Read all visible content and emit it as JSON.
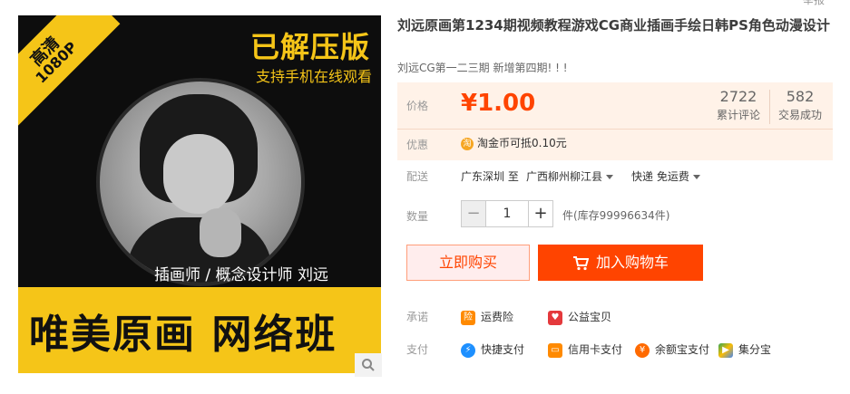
{
  "top_cut": "举报",
  "image": {
    "ribbon_line1": "高清",
    "ribbon_line2": "1080P",
    "badge": "已解压版",
    "mobile_text": "支持手机在线观看",
    "role_text": "插画师 / 概念设计师  刘远",
    "banner_text": "唯美原画 网络班",
    "zoom_icon": "search-icon"
  },
  "product": {
    "title": "刘远原画第1234期视频教程游戏CG商业插画手绘日韩PS角色动漫设计",
    "subtitle": "刘远CG第一二三期 新增第四期! ! !"
  },
  "price": {
    "label": "价格",
    "currency": "¥",
    "value": "1.00",
    "reviews_count": "2722",
    "reviews_label": "累计评论",
    "sales_count": "582",
    "sales_label": "交易成功",
    "promo_label": "优惠",
    "promo_text": "淘金币可抵0.10元"
  },
  "shipping": {
    "label": "配送",
    "from": "广东深圳 至",
    "to": "广西柳州柳江县",
    "method": "快递 免运费"
  },
  "quantity": {
    "label": "数量",
    "value": "1",
    "minus": "−",
    "plus": "+",
    "stock": "件(库存99996634件)"
  },
  "actions": {
    "buy_now": "立即购买",
    "add_to_cart": "加入购物车"
  },
  "promise": {
    "label": "承诺",
    "items": [
      "运费险",
      "公益宝贝"
    ]
  },
  "payment": {
    "label": "支付",
    "items": [
      "快捷支付",
      "信用卡支付",
      "余额宝支付",
      "集分宝"
    ]
  },
  "colors": {
    "accent": "#ff4400",
    "brand_yellow": "#f5c518"
  }
}
